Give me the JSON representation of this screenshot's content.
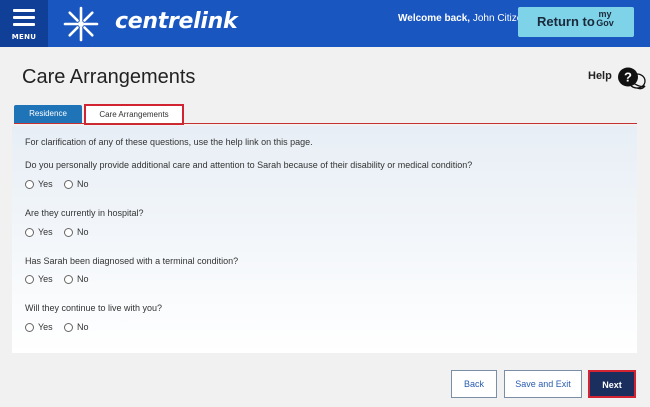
{
  "header": {
    "menu_label": "MENU",
    "brand": "centrelink",
    "welcome_prefix": "Welcome back,",
    "user_name": "John Citizen",
    "return_label": "Return to",
    "mygov_line1": "my",
    "mygov_line2": "Gov"
  },
  "page": {
    "title": "Care Arrangements",
    "help_label": "Help",
    "help_icon": "question-bubble-icon"
  },
  "tabs": [
    {
      "label": "Residence",
      "active": false
    },
    {
      "label": "Care Arrangements",
      "active": true
    }
  ],
  "form": {
    "intro": "For clarification of any of these questions, use the help link on this page.",
    "questions": [
      {
        "text": "Do you personally provide additional care and attention to Sarah because of their disability or medical condition?",
        "options": [
          "Yes",
          "No"
        ]
      },
      {
        "text": "Are they currently in hospital?",
        "options": [
          "Yes",
          "No"
        ]
      },
      {
        "text": "Has Sarah been diagnosed with a terminal condition?",
        "options": [
          "Yes",
          "No"
        ]
      },
      {
        "text": "Will they continue to live with you?",
        "options": [
          "Yes",
          "No"
        ]
      }
    ]
  },
  "buttons": {
    "back": "Back",
    "save_exit": "Save and Exit",
    "next": "Next"
  },
  "colors": {
    "header_blue": "#1a56c0",
    "menu_blue": "#0f3f96",
    "mygov_teal": "#7fd3e9",
    "tab_blue": "#1f73b7",
    "highlight_red": "#d22333",
    "next_navy": "#1b2f5e"
  }
}
